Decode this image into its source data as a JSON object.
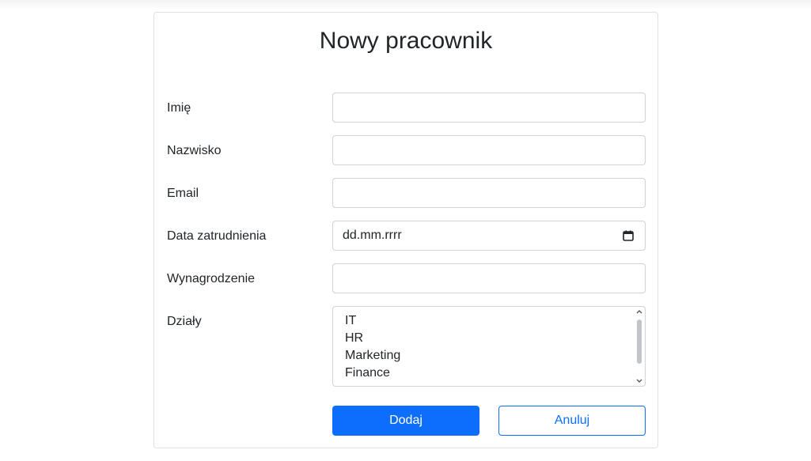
{
  "form": {
    "title": "Nowy pracownik",
    "fields": [
      {
        "label": "Imię",
        "value": "",
        "placeholder": ""
      },
      {
        "label": "Nazwisko",
        "value": "",
        "placeholder": ""
      },
      {
        "label": "Email",
        "value": "",
        "placeholder": ""
      },
      {
        "label": "Data zatrudnienia",
        "value": "",
        "placeholder": "dd.mm.rrrr"
      },
      {
        "label": "Wynagrodzenie",
        "value": "",
        "placeholder": ""
      }
    ],
    "departments": {
      "label": "Działy",
      "options": [
        "IT",
        "HR",
        "Marketing",
        "Finance"
      ]
    },
    "buttons": {
      "submit_label": "Dodaj",
      "cancel_label": "Anuluj"
    }
  },
  "colors": {
    "primary": "#0d6efd",
    "border": "#ced4da",
    "text": "#212529"
  },
  "icons": {
    "date": "calendar-icon",
    "scroll_up": "chevron-up-icon",
    "scroll_down": "chevron-down-icon"
  }
}
